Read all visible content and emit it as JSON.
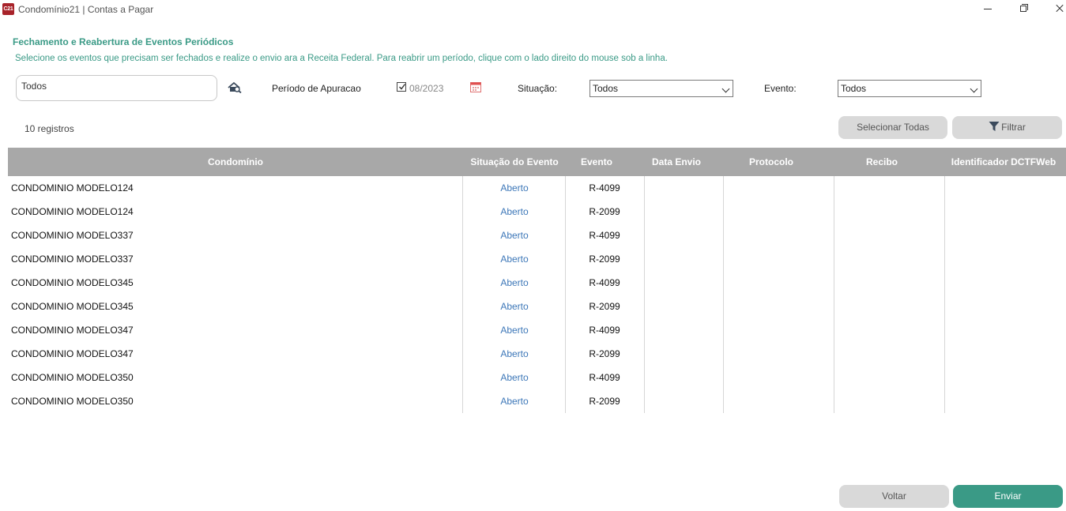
{
  "window": {
    "app_icon_text": "C21",
    "title": "Condomínio21 | Contas a Pagar"
  },
  "header": {
    "title": "Fechamento e Reabertura de Eventos Periódicos",
    "subtitle": "Selecione os eventos que precisam ser fechados e realize o envio ara a Receita Federal. Para reabrir um período, clique com o lado direito do mouse sob a linha."
  },
  "filters": {
    "condominio_value": "Todos",
    "periodo_label": "Período de Apuracao",
    "periodo_checked": true,
    "periodo_value": "08/2023",
    "situacao_label": "Situação:",
    "situacao_value": "Todos",
    "evento_label": "Evento:",
    "evento_value": "Todos"
  },
  "toolbar": {
    "record_count": "10 registros",
    "select_all_label": "Selecionar Todas",
    "filter_label": "Filtrar"
  },
  "table": {
    "columns": [
      "Condomínio",
      "Situação do Evento",
      "Evento",
      "Data Envio",
      "Protocolo",
      "Recibo",
      "Identificador DCTFWeb"
    ],
    "rows": [
      {
        "condominio": "CONDOMINIO MODELO124",
        "situacao": "Aberto",
        "evento": "R-4099",
        "data_envio": "",
        "protocolo": "",
        "recibo": "",
        "identificador": ""
      },
      {
        "condominio": "CONDOMINIO MODELO124",
        "situacao": "Aberto",
        "evento": "R-2099",
        "data_envio": "",
        "protocolo": "",
        "recibo": "",
        "identificador": ""
      },
      {
        "condominio": "CONDOMINIO MODELO337",
        "situacao": "Aberto",
        "evento": "R-4099",
        "data_envio": "",
        "protocolo": "",
        "recibo": "",
        "identificador": ""
      },
      {
        "condominio": "CONDOMINIO MODELO337",
        "situacao": "Aberto",
        "evento": "R-2099",
        "data_envio": "",
        "protocolo": "",
        "recibo": "",
        "identificador": ""
      },
      {
        "condominio": "CONDOMINIO MODELO345",
        "situacao": "Aberto",
        "evento": "R-4099",
        "data_envio": "",
        "protocolo": "",
        "recibo": "",
        "identificador": ""
      },
      {
        "condominio": "CONDOMINIO MODELO345",
        "situacao": "Aberto",
        "evento": "R-2099",
        "data_envio": "",
        "protocolo": "",
        "recibo": "",
        "identificador": ""
      },
      {
        "condominio": "CONDOMINIO MODELO347",
        "situacao": "Aberto",
        "evento": "R-4099",
        "data_envio": "",
        "protocolo": "",
        "recibo": "",
        "identificador": ""
      },
      {
        "condominio": "CONDOMINIO MODELO347",
        "situacao": "Aberto",
        "evento": "R-2099",
        "data_envio": "",
        "protocolo": "",
        "recibo": "",
        "identificador": ""
      },
      {
        "condominio": "CONDOMINIO MODELO350",
        "situacao": "Aberto",
        "evento": "R-4099",
        "data_envio": "",
        "protocolo": "",
        "recibo": "",
        "identificador": ""
      },
      {
        "condominio": "CONDOMINIO MODELO350",
        "situacao": "Aberto",
        "evento": "R-2099",
        "data_envio": "",
        "protocolo": "",
        "recibo": "",
        "identificador": ""
      }
    ]
  },
  "footer": {
    "back_label": "Voltar",
    "send_label": "Enviar"
  },
  "colors": {
    "accent": "#3a9a86",
    "header_gray": "#a8a8a8",
    "link_blue": "#3d77b8",
    "button_gray": "#d9d9d9",
    "app_icon": "#a8232a"
  },
  "icons": [
    "home-search-icon",
    "checkbox-icon",
    "calendar-icon",
    "chevron-down-icon",
    "funnel-icon",
    "minimize-icon",
    "restore-icon",
    "close-icon"
  ]
}
